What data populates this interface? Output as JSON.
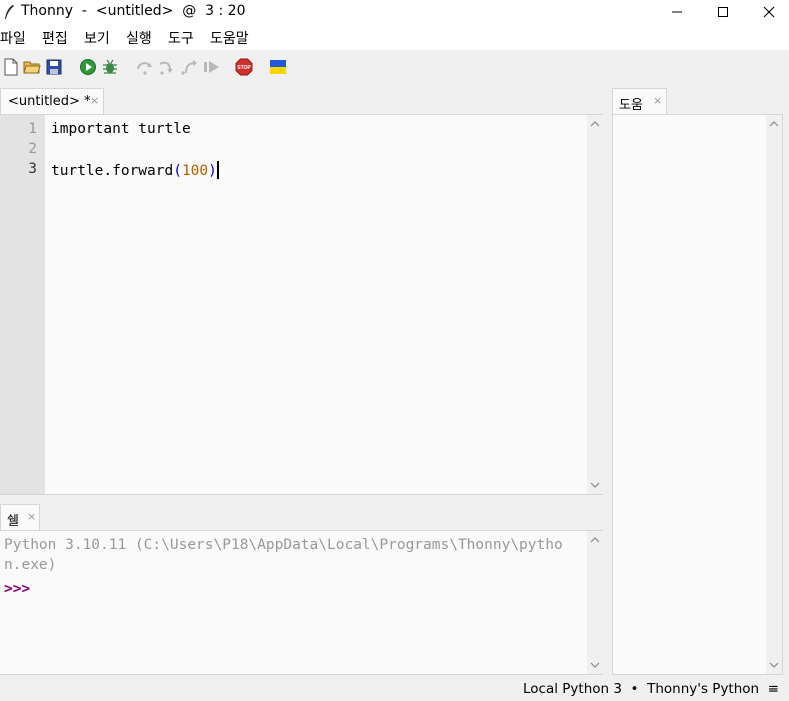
{
  "window": {
    "title": "Thonny  -  <untitled>  @  3 : 20",
    "app_icon": "feather-pen-icon"
  },
  "menu": {
    "items": [
      {
        "label": "파일"
      },
      {
        "label": "편집"
      },
      {
        "label": "보기"
      },
      {
        "label": "실행"
      },
      {
        "label": "도구"
      },
      {
        "label": "도움말"
      }
    ]
  },
  "toolbar": {
    "buttons": [
      {
        "icon": "new-file-icon"
      },
      {
        "icon": "open-folder-icon"
      },
      {
        "icon": "save-icon"
      },
      {
        "icon": "run-icon"
      },
      {
        "icon": "debug-bug-icon"
      },
      {
        "icon": "step-over-icon"
      },
      {
        "icon": "step-into-icon"
      },
      {
        "icon": "step-out-icon"
      },
      {
        "icon": "resume-icon"
      },
      {
        "icon": "stop-icon"
      },
      {
        "icon": "ukraine-flag-icon"
      }
    ],
    "stop_text": "STOP"
  },
  "editor": {
    "tab_label": "<untitled> *",
    "close_glyph": "×",
    "lines": [
      {
        "num": "1",
        "text": "important turtle"
      },
      {
        "num": "2",
        "text": ""
      },
      {
        "num": "3",
        "pre": "turtle.forward",
        "open": "(",
        "arg": "100",
        "close": ")"
      }
    ]
  },
  "shell": {
    "tab_label": "쉘",
    "close_glyph": "×",
    "lines": [
      "Python 3.10.11 (C:\\Users\\P18\\AppData\\Local\\Programs\\Thonny\\pytho",
      "n.exe)"
    ],
    "prompt": ">>>"
  },
  "help_panel": {
    "tab_label": "도움",
    "close_glyph": "×"
  },
  "status": {
    "text": "Local Python 3  •  Thonny's Python  ≡"
  },
  "colors": {
    "gutter": "#e3e3e3",
    "editor_bg": "#fafafa",
    "paren": "#0000cc",
    "number": "#b85c00",
    "prompt": "#800080"
  }
}
